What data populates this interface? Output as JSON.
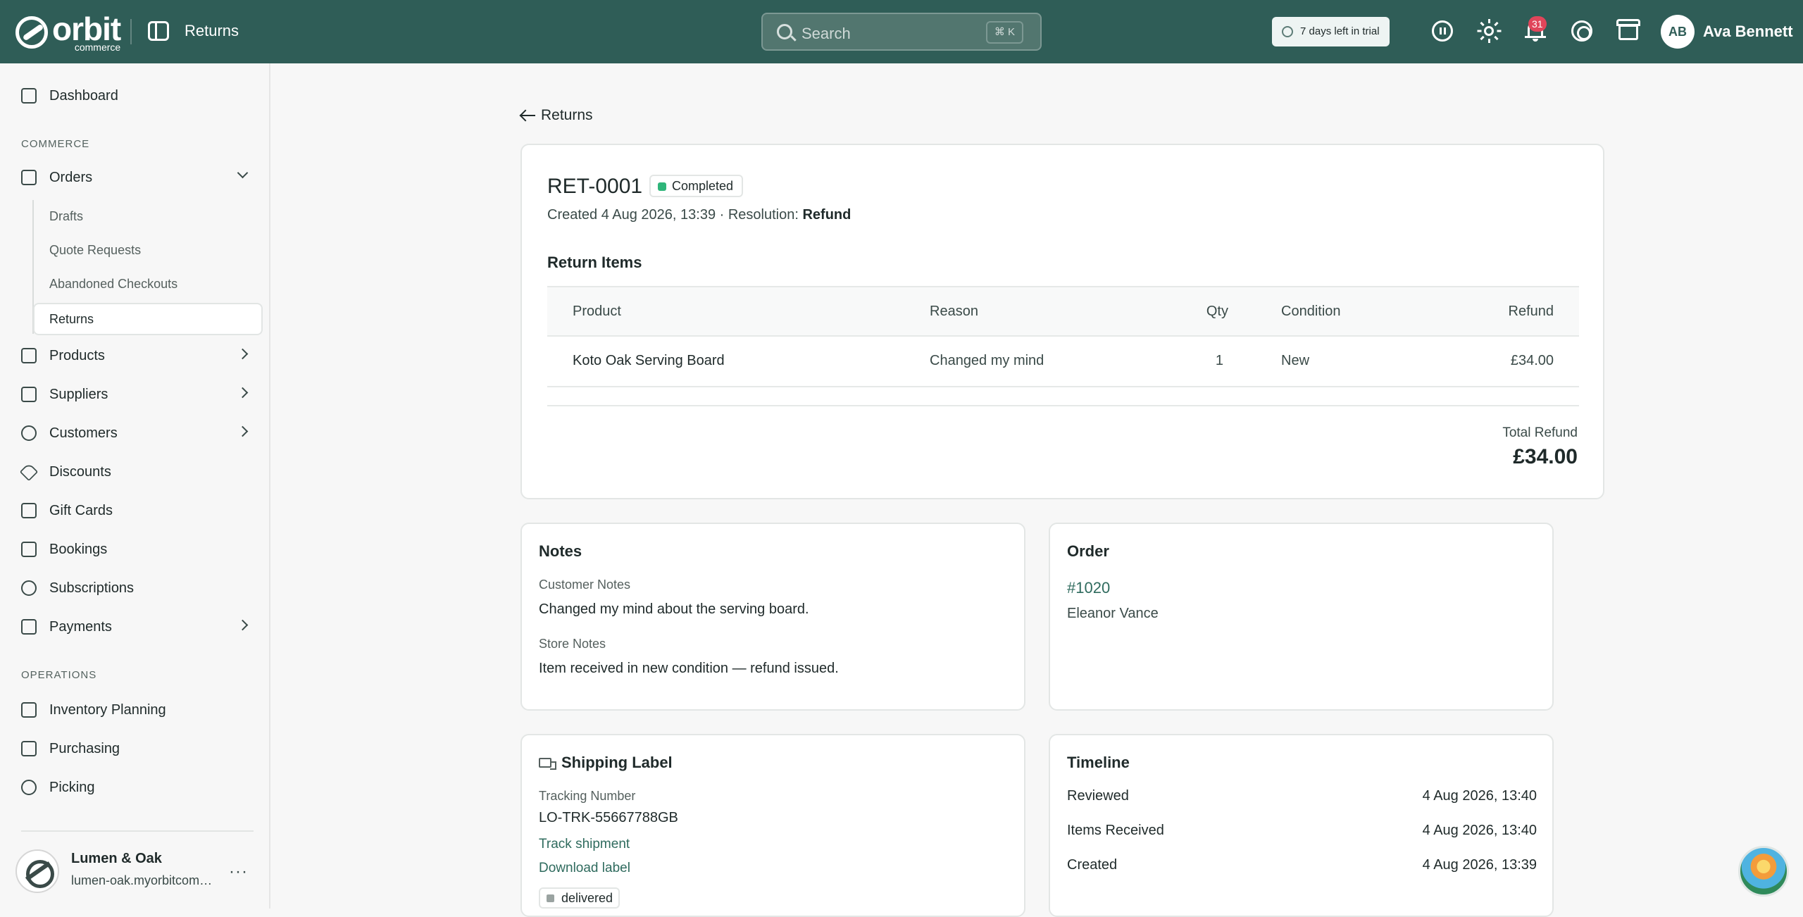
{
  "topbar": {
    "logo_word": "orbit",
    "logo_sub": "commerce",
    "page_title": "Returns",
    "search_placeholder": "Search",
    "search_shortcut": "⌘ K",
    "trial_label": "7 days left in trial",
    "notification_count": "31",
    "user_initials": "AB",
    "user_name": "Ava Bennett"
  },
  "sidebar": {
    "dashboard": "Dashboard",
    "section_commerce": "COMMERCE",
    "orders": "Orders",
    "orders_sub": [
      "Drafts",
      "Quote Requests",
      "Abandoned Checkouts",
      "Returns"
    ],
    "products": "Products",
    "suppliers": "Suppliers",
    "customers": "Customers",
    "discounts": "Discounts",
    "gift_cards": "Gift Cards",
    "bookings": "Bookings",
    "subscriptions": "Subscriptions",
    "payments": "Payments",
    "section_operations": "OPERATIONS",
    "inventory_planning": "Inventory Planning",
    "purchasing": "Purchasing",
    "picking": "Picking",
    "store_name": "Lumen & Oak",
    "store_url": "lumen-oak.myorbitcommerce.com",
    "more_label": "···"
  },
  "main": {
    "back_label": "Returns",
    "return_id": "RET-0001",
    "status": "Completed",
    "created_prefix": "Created 4 Aug 2026, 13:39 · Resolution: ",
    "resolution": "Refund",
    "items_heading": "Return Items",
    "columns": [
      "Product",
      "Reason",
      "Qty",
      "Condition",
      "Refund"
    ],
    "items": [
      {
        "product": "Koto Oak Serving Board",
        "reason": "Changed my mind",
        "qty": "1",
        "condition": "New",
        "refund": "£34.00"
      }
    ],
    "total_refund_label": "Total Refund",
    "total_refund": "£34.00"
  },
  "notes": {
    "heading": "Notes",
    "customer_label": "Customer Notes",
    "customer_text": "Changed my mind about the serving board.",
    "store_label": "Store Notes",
    "store_text": "Item received in new condition — refund issued."
  },
  "order": {
    "heading": "Order",
    "number": "#1020",
    "customer": "Eleanor Vance"
  },
  "shipping": {
    "heading": "Shipping Label",
    "tracking_label": "Tracking Number",
    "tracking_number": "LO-TRK-55667788GB",
    "track_link": "Track shipment",
    "download_link": "Download label",
    "status": "delivered"
  },
  "timeline": {
    "heading": "Timeline",
    "events": [
      {
        "label": "Reviewed",
        "time": "4 Aug 2026, 13:40"
      },
      {
        "label": "Items Received",
        "time": "4 Aug 2026, 13:40"
      },
      {
        "label": "Created",
        "time": "4 Aug 2026, 13:39"
      }
    ]
  },
  "colors": {
    "topbar": "#2f5d57",
    "accent_link": "#2f6b5e",
    "status_completed": "#2fb57a",
    "badge": "#e0455a"
  }
}
